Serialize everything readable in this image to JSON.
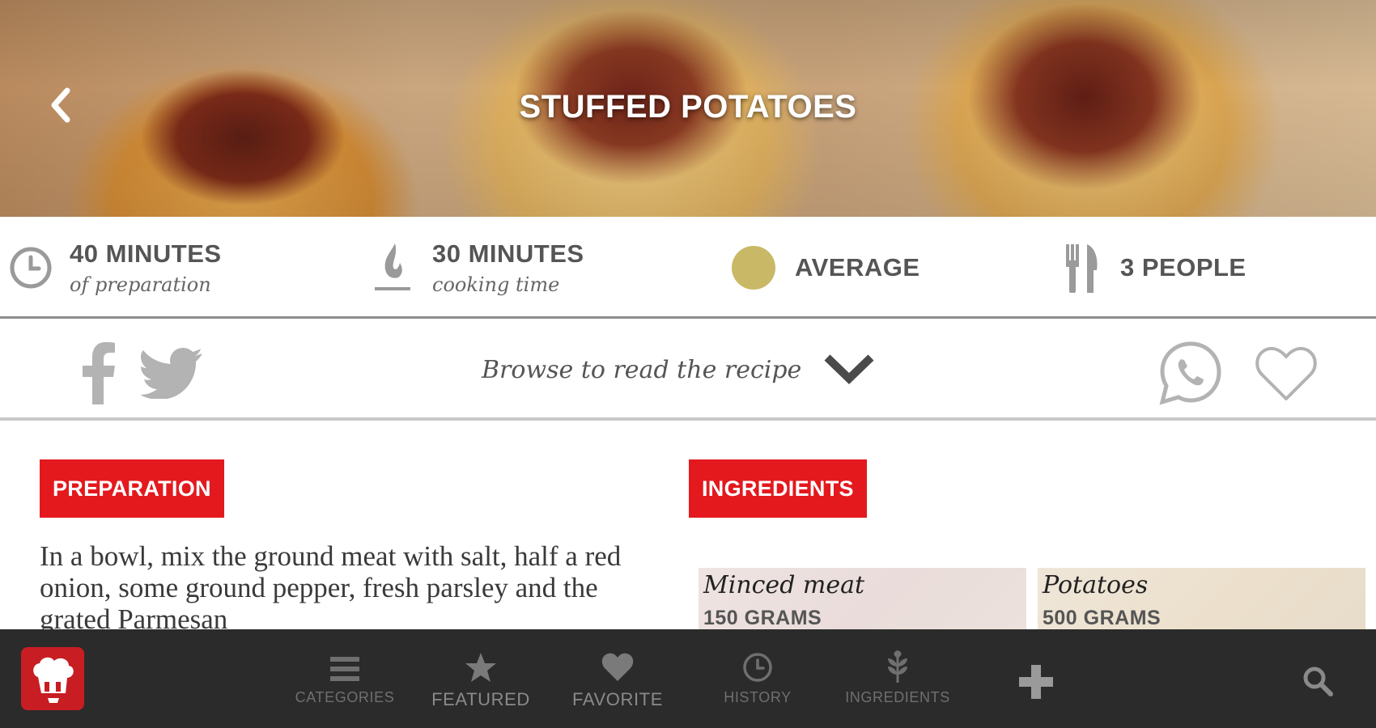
{
  "hero": {
    "title": "STUFFED POTATOES",
    "back_icon": "chevron-left-icon"
  },
  "info": {
    "prep_time": {
      "value": "40 MINUTES",
      "caption": "of preparation",
      "icon": "clock-icon"
    },
    "cook_time": {
      "value": "30 MINUTES",
      "caption": "cooking time",
      "icon": "flame-icon"
    },
    "difficulty": {
      "value": "AVERAGE",
      "icon": "difficulty-dot-icon",
      "color": "#c9b866"
    },
    "servings": {
      "value": "3 PEOPLE",
      "icon": "fork-knife-icon"
    }
  },
  "share": {
    "facebook_icon": "facebook-icon",
    "twitter_icon": "twitter-icon",
    "browse_text": "Browse to read the recipe",
    "whatsapp_icon": "whatsapp-icon",
    "favorite_icon": "heart-icon"
  },
  "preparation": {
    "badge": "PREPARATION",
    "text": "In a bowl, mix the ground meat with salt, half a red onion, some ground pepper, fresh parsley and the grated Parmesan"
  },
  "ingredients": {
    "badge": "INGREDIENTS",
    "items": [
      {
        "name": "Minced meat",
        "quantity": "150 GRAMS"
      },
      {
        "name": "Potatoes",
        "quantity": "500 GRAMS"
      }
    ]
  },
  "nav": {
    "categories": "CATEGORIES",
    "featured": "FEATURED",
    "favorite": "FAVORITE",
    "history": "HISTORY",
    "ingredients": "INGREDIENTS"
  },
  "colors": {
    "accent_red": "#e3191e",
    "nav_background": "#2b2b2b",
    "difficulty_gold": "#c9b866"
  }
}
